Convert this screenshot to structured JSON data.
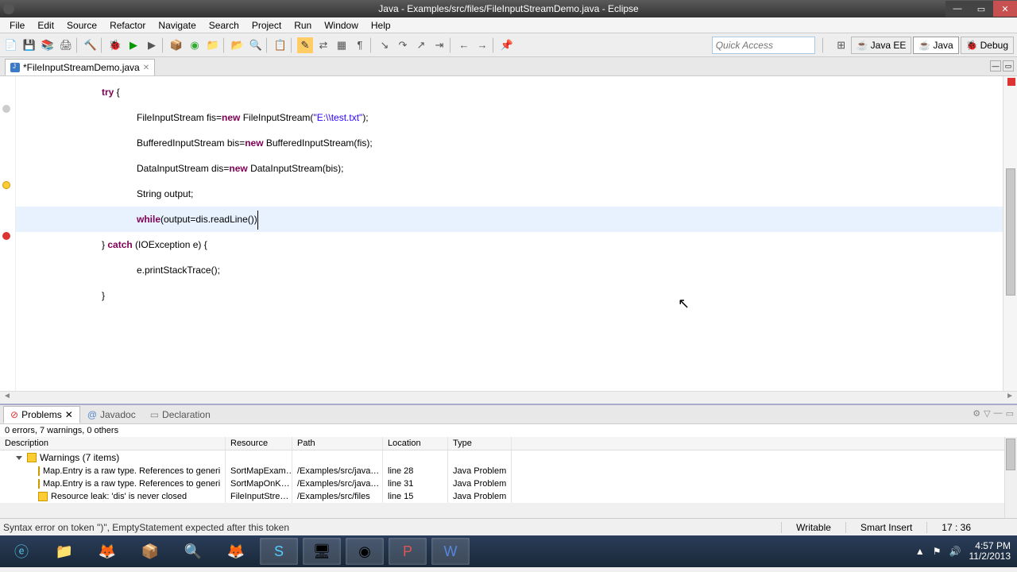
{
  "title": "Java - Examples/src/files/FileInputStreamDemo.java - Eclipse",
  "menus": [
    "File",
    "Edit",
    "Source",
    "Refactor",
    "Navigate",
    "Search",
    "Project",
    "Run",
    "Window",
    "Help"
  ],
  "quick_access_placeholder": "Quick Access",
  "perspectives": [
    {
      "label": "Java EE",
      "active": false
    },
    {
      "label": "Java",
      "active": true
    },
    {
      "label": "Debug",
      "active": false
    }
  ],
  "editor_tab": "*FileInputStreamDemo.java",
  "code_lines": [
    {
      "indent": 2,
      "tokens": [
        {
          "t": "try",
          "c": "kw"
        },
        {
          "t": " {"
        }
      ]
    },
    {
      "indent": 3,
      "tokens": [
        {
          "t": "FileInputStream fis="
        },
        {
          "t": "new",
          "c": "kw"
        },
        {
          "t": " FileInputStream("
        },
        {
          "t": "\"E:\\\\test.txt\"",
          "c": "str"
        },
        {
          "t": ");"
        }
      ]
    },
    {
      "indent": 3,
      "tokens": [
        {
          "t": "BufferedInputStream bis="
        },
        {
          "t": "new",
          "c": "kw"
        },
        {
          "t": " BufferedInputStream(fis);"
        }
      ]
    },
    {
      "indent": 3,
      "tokens": [
        {
          "t": "DataInputStream dis="
        },
        {
          "t": "new",
          "c": "kw"
        },
        {
          "t": " DataInputStream(bis);"
        }
      ]
    },
    {
      "indent": 3,
      "tokens": [
        {
          "t": "String output;"
        }
      ]
    },
    {
      "indent": 3,
      "hl": true,
      "tokens": [
        {
          "t": "while",
          "c": "kw"
        },
        {
          "t": "(output=dis.readLine())"
        }
      ],
      "caret": true
    },
    {
      "indent": 3,
      "tokens": [
        {
          "t": ""
        }
      ]
    },
    {
      "indent": 3,
      "tokens": [
        {
          "t": ""
        }
      ]
    },
    {
      "indent": 2,
      "tokens": [
        {
          "t": "} "
        },
        {
          "t": "catch",
          "c": "kw"
        },
        {
          "t": " (IOException e) {"
        }
      ]
    },
    {
      "indent": 3,
      "tokens": [
        {
          "t": "e.printStackTrace();"
        }
      ]
    },
    {
      "indent": 2,
      "tokens": [
        {
          "t": "}"
        }
      ]
    }
  ],
  "bottom_tabs": [
    "Problems",
    "Javadoc",
    "Declaration"
  ],
  "problems_summary": "0 errors, 7 warnings, 0 others",
  "problems_columns": [
    "Description",
    "Resource",
    "Path",
    "Location",
    "Type"
  ],
  "problems_group": "Warnings (7 items)",
  "problems_rows": [
    {
      "desc": "Map.Entry is a raw type. References to generi",
      "res": "SortMapExam…",
      "path": "/Examples/src/java…",
      "loc": "line 28",
      "type": "Java Problem"
    },
    {
      "desc": "Map.Entry is a raw type. References to generi",
      "res": "SortMapOnK…",
      "path": "/Examples/src/java…",
      "loc": "line 31",
      "type": "Java Problem"
    },
    {
      "desc": "Resource leak: 'dis' is never closed",
      "res": "FileInputStre…",
      "path": "/Examples/src/files",
      "loc": "line 15",
      "type": "Java Problem"
    }
  ],
  "status": {
    "msg": "Syntax error on token \")\", EmptyStatement expected after this token",
    "writable": "Writable",
    "mode": "Smart Insert",
    "pos": "17 : 36"
  },
  "tray": {
    "time": "4:57 PM",
    "date": "11/2/2013"
  }
}
